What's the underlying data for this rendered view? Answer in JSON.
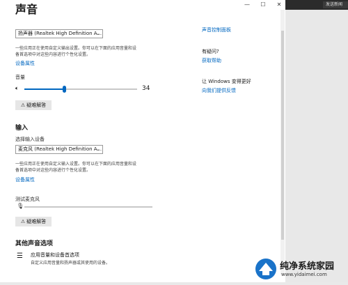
{
  "window": {
    "title": "声音",
    "controls": [
      "—",
      "☐",
      "✕"
    ]
  },
  "browser_tab": "发送新闻",
  "output": {
    "device_value": "扬声器 (Realtek High Definition A...",
    "desc_line1": "一些应用正在使用自定义输出设置。你可以在下面的应用音量和设",
    "desc_line2": "备首选项中对这些内容进行个性化设置。",
    "device_props_link": "设备属性",
    "volume_label": "音量",
    "volume_value": "34",
    "volume_level": 0.34,
    "troubleshoot_label": "疑难解答"
  },
  "input": {
    "section_title": "输入",
    "select_label": "选择输入设备",
    "device_value": "麦克风 (Realtek High Definition A...",
    "desc_line1": "一些应用正在使用自定义输入设置。你可以在下面的应用音量和设",
    "desc_line2": "备首选项中对这些内容进行个性化设置。",
    "device_props_link": "设备属性",
    "test_mic_label": "测试麦克风",
    "troubleshoot_label": "疑难解答"
  },
  "other": {
    "section_title": "其他声音选项",
    "app_volume_title": "应用音量和设备首选项",
    "app_volume_desc": "自定义应用音量和扬声器或其使用的设备。"
  },
  "right": {
    "top_link": "声音控制面板",
    "help_title": "有疑问?",
    "help_link": "获取帮助",
    "improve_title": "让 Windows 变得更好",
    "improve_link": "向我们提供反馈"
  },
  "watermark": {
    "text_cn": "纯净系统家园",
    "text_url": "www.yidaimei.com"
  }
}
